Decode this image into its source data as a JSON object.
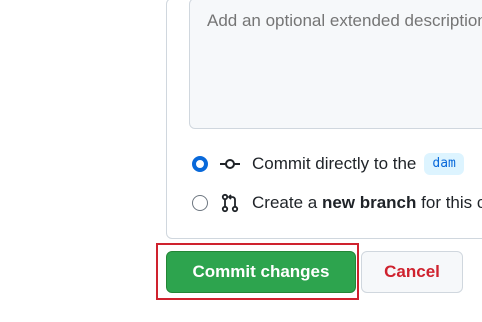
{
  "description_field": {
    "placeholder": "Add an optional extended description…"
  },
  "commit_options": {
    "direct": {
      "label": "Commit directly to the",
      "branch_name": "dam",
      "selected": true
    },
    "new_branch": {
      "label_prefix": "Create a",
      "label_bold": "new branch",
      "label_suffix": "for this commit and start a pull request.",
      "selected": false
    }
  },
  "actions": {
    "commit_label": "Commit changes",
    "cancel_label": "Cancel"
  },
  "colors": {
    "primary_button": "#2da44e",
    "cancel_text": "#cf222e",
    "radio_selected": "#0969da",
    "highlight_box": "#cf222e"
  },
  "icons": {
    "direct_commit": "git-commit-icon",
    "new_branch": "git-pull-request-icon"
  }
}
